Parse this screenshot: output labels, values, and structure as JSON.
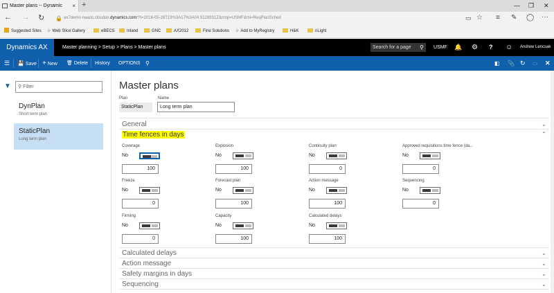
{
  "browser": {
    "tab_title": "Master plans -- Dynamic",
    "tab_close": "×",
    "new_tab": "+",
    "url_prefix": "ax7demo-naaos.cloudax.",
    "url_domain": "dynamics.com",
    "url_rest": "/?t=2016-05-26T19%3A17%3A04.5128931Z&cmp=USMF&mi=ReqPlanSched",
    "favorites": [
      {
        "label": "Suggested Sites",
        "icon": "bing-icon"
      },
      {
        "label": "Web Slice Gallery",
        "icon": "star-icon"
      },
      {
        "label": "eBECS",
        "icon": "folder-icon"
      },
      {
        "label": "Inland",
        "icon": "folder-icon"
      },
      {
        "label": "GNC",
        "icon": "folder-icon"
      },
      {
        "label": "AX2012",
        "icon": "folder-icon"
      },
      {
        "label": "Fine Solutions",
        "icon": "folder-icon"
      },
      {
        "label": "Add to MyRegistry",
        "icon": "star-icon"
      },
      {
        "label": "H&K",
        "icon": "folder-icon"
      },
      {
        "label": "nLight",
        "icon": "folder-icon"
      }
    ]
  },
  "app": {
    "name": "Dynamics AX",
    "breadcrumb": "Master planning  >  Setup  >  Plans  >  Master plans",
    "search_placeholder": "Search for a page",
    "company": "USMF",
    "user": "Andrew Lencsak"
  },
  "actions": {
    "save": "Save",
    "new": "New",
    "delete": "Delete",
    "history": "History",
    "options": "OPTIONS"
  },
  "list": {
    "filter_placeholder": "Filter",
    "items": [
      {
        "name": "DynPlan",
        "desc": "Short term plan"
      },
      {
        "name": "StaticPlan",
        "desc": "Long term plan"
      }
    ]
  },
  "main": {
    "title": "Master plans",
    "plan_label": "Plan",
    "plan_value": "StaticPlan",
    "name_label": "Name",
    "name_value": "Long term plan",
    "sections": {
      "general": "General",
      "time_fences": "Time fences in days",
      "calculated_delays": "Calculated delays",
      "action_message": "Action message",
      "safety_margins": "Safety margins in days",
      "sequencing": "Sequencing"
    },
    "fields": [
      {
        "label": "Coverage",
        "toggle": "No",
        "value": "100"
      },
      {
        "label": "Explosion",
        "toggle": "No",
        "value": "100"
      },
      {
        "label": "Continuity plan",
        "toggle": "No",
        "value": "0"
      },
      {
        "label": "Approved requisitions time fence (da...",
        "toggle": "No",
        "value": "0"
      },
      {
        "label": "Freeze",
        "toggle": "No",
        "value": "0"
      },
      {
        "label": "Forecast plan",
        "toggle": "No",
        "value": "100"
      },
      {
        "label": "Action message",
        "toggle": "No",
        "value": "100"
      },
      {
        "label": "Sequencing",
        "toggle": "No",
        "value": "0"
      },
      {
        "label": "Firming",
        "toggle": "No",
        "value": "0"
      },
      {
        "label": "Capacity",
        "toggle": "No",
        "value": "100"
      },
      {
        "label": "Calculated delays",
        "toggle": "No",
        "value": "100"
      }
    ]
  },
  "colors": {
    "brand_blue": "#0f5fad",
    "selected_item": "#c7dff4",
    "highlight": "#ffff00"
  }
}
